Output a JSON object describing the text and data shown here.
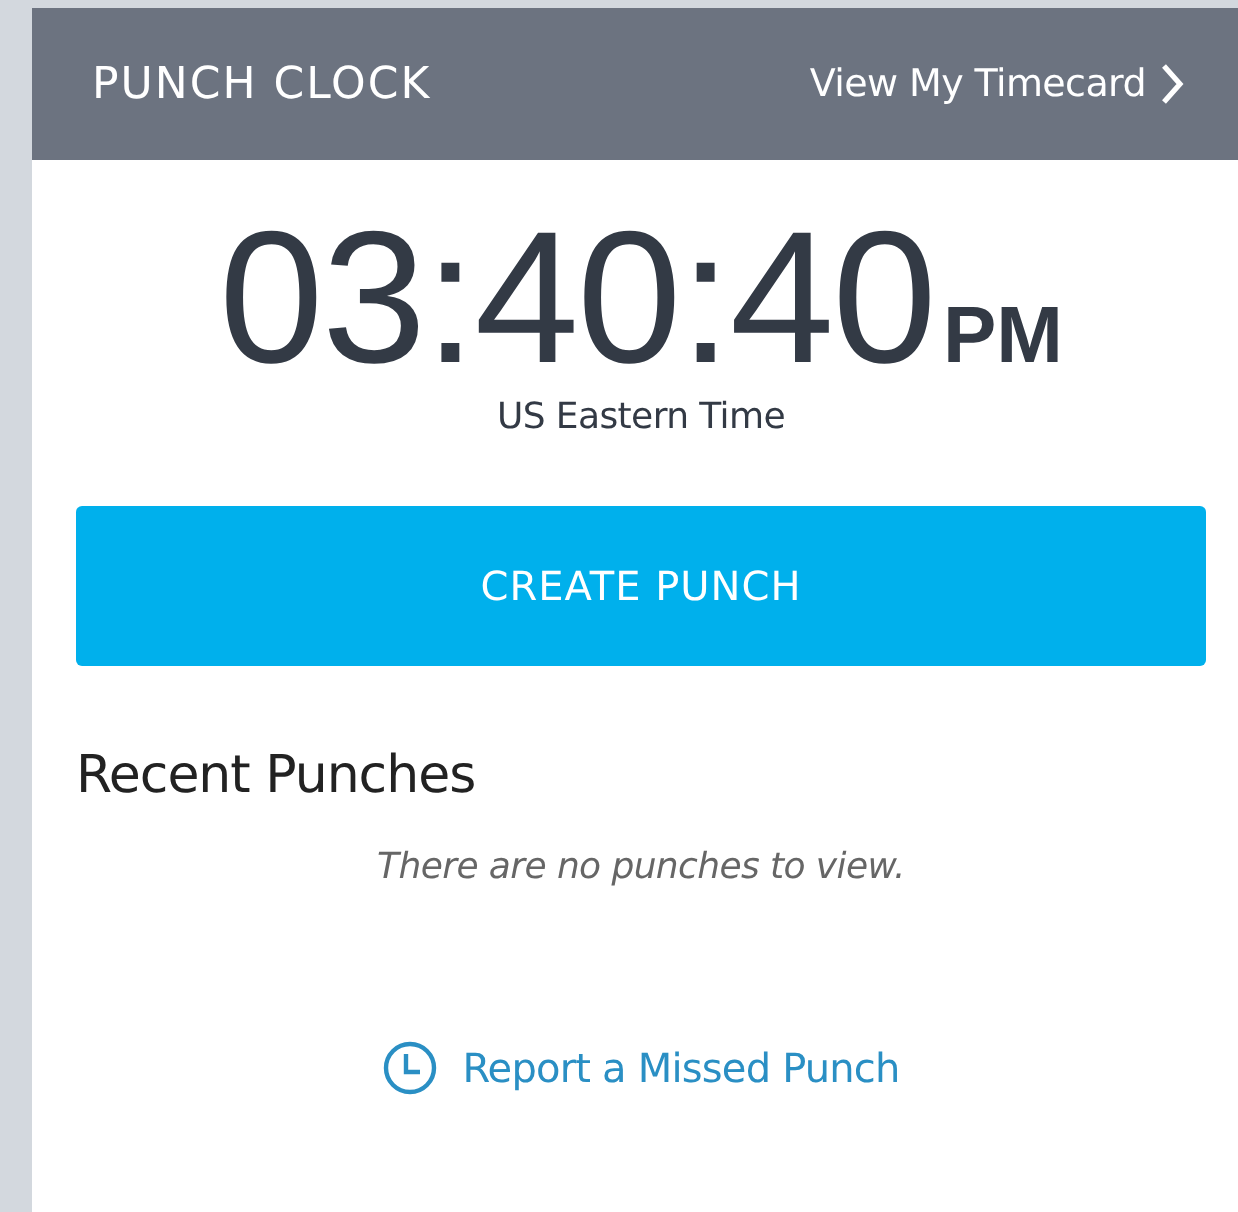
{
  "header": {
    "title": "PUNCH CLOCK",
    "link": "View My Timecard"
  },
  "clock": {
    "time": "03:40:40",
    "meridiem": "PM",
    "timezone": "US Eastern Time"
  },
  "primary_button": "CREATE PUNCH",
  "recent_punches": {
    "heading": "Recent Punches",
    "empty_message": "There are no punches to view."
  },
  "footer_link": "Report a Missed Punch"
}
